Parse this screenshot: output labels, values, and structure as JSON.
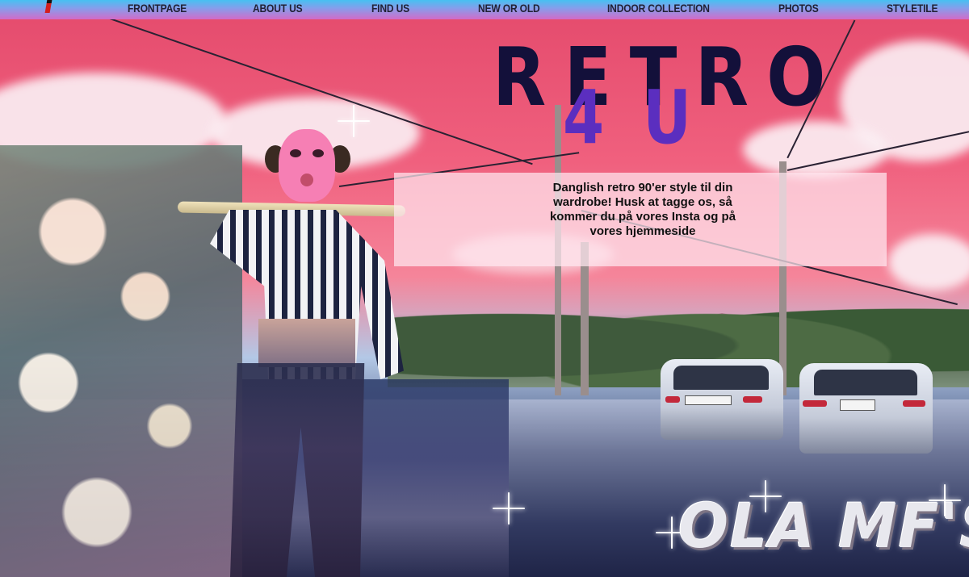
{
  "nav": {
    "items": [
      {
        "label": "FRONTPAGE"
      },
      {
        "label": "ABOUT US"
      },
      {
        "label": "FIND US"
      },
      {
        "label": "NEW OR OLD"
      },
      {
        "label": "INDOOR COLLECTION"
      },
      {
        "label": "PHOTOS"
      },
      {
        "label": "STYLETILE"
      }
    ]
  },
  "hero": {
    "title_main": "RETRO",
    "title_sub": "4U",
    "intro": "Danglish retro 90'er style til din wardrobe! Husk at tagge os, så kommer du på vores Insta og på vores hjemmeside"
  },
  "brand": {
    "label": "OLA MF'S"
  },
  "colors": {
    "nav_gradient_top": "#47c0f2",
    "nav_gradient_bottom": "#d16bc8",
    "title_main": "#13103a",
    "title_sub": "#5b2ebf",
    "sky": "#e44a6c"
  }
}
